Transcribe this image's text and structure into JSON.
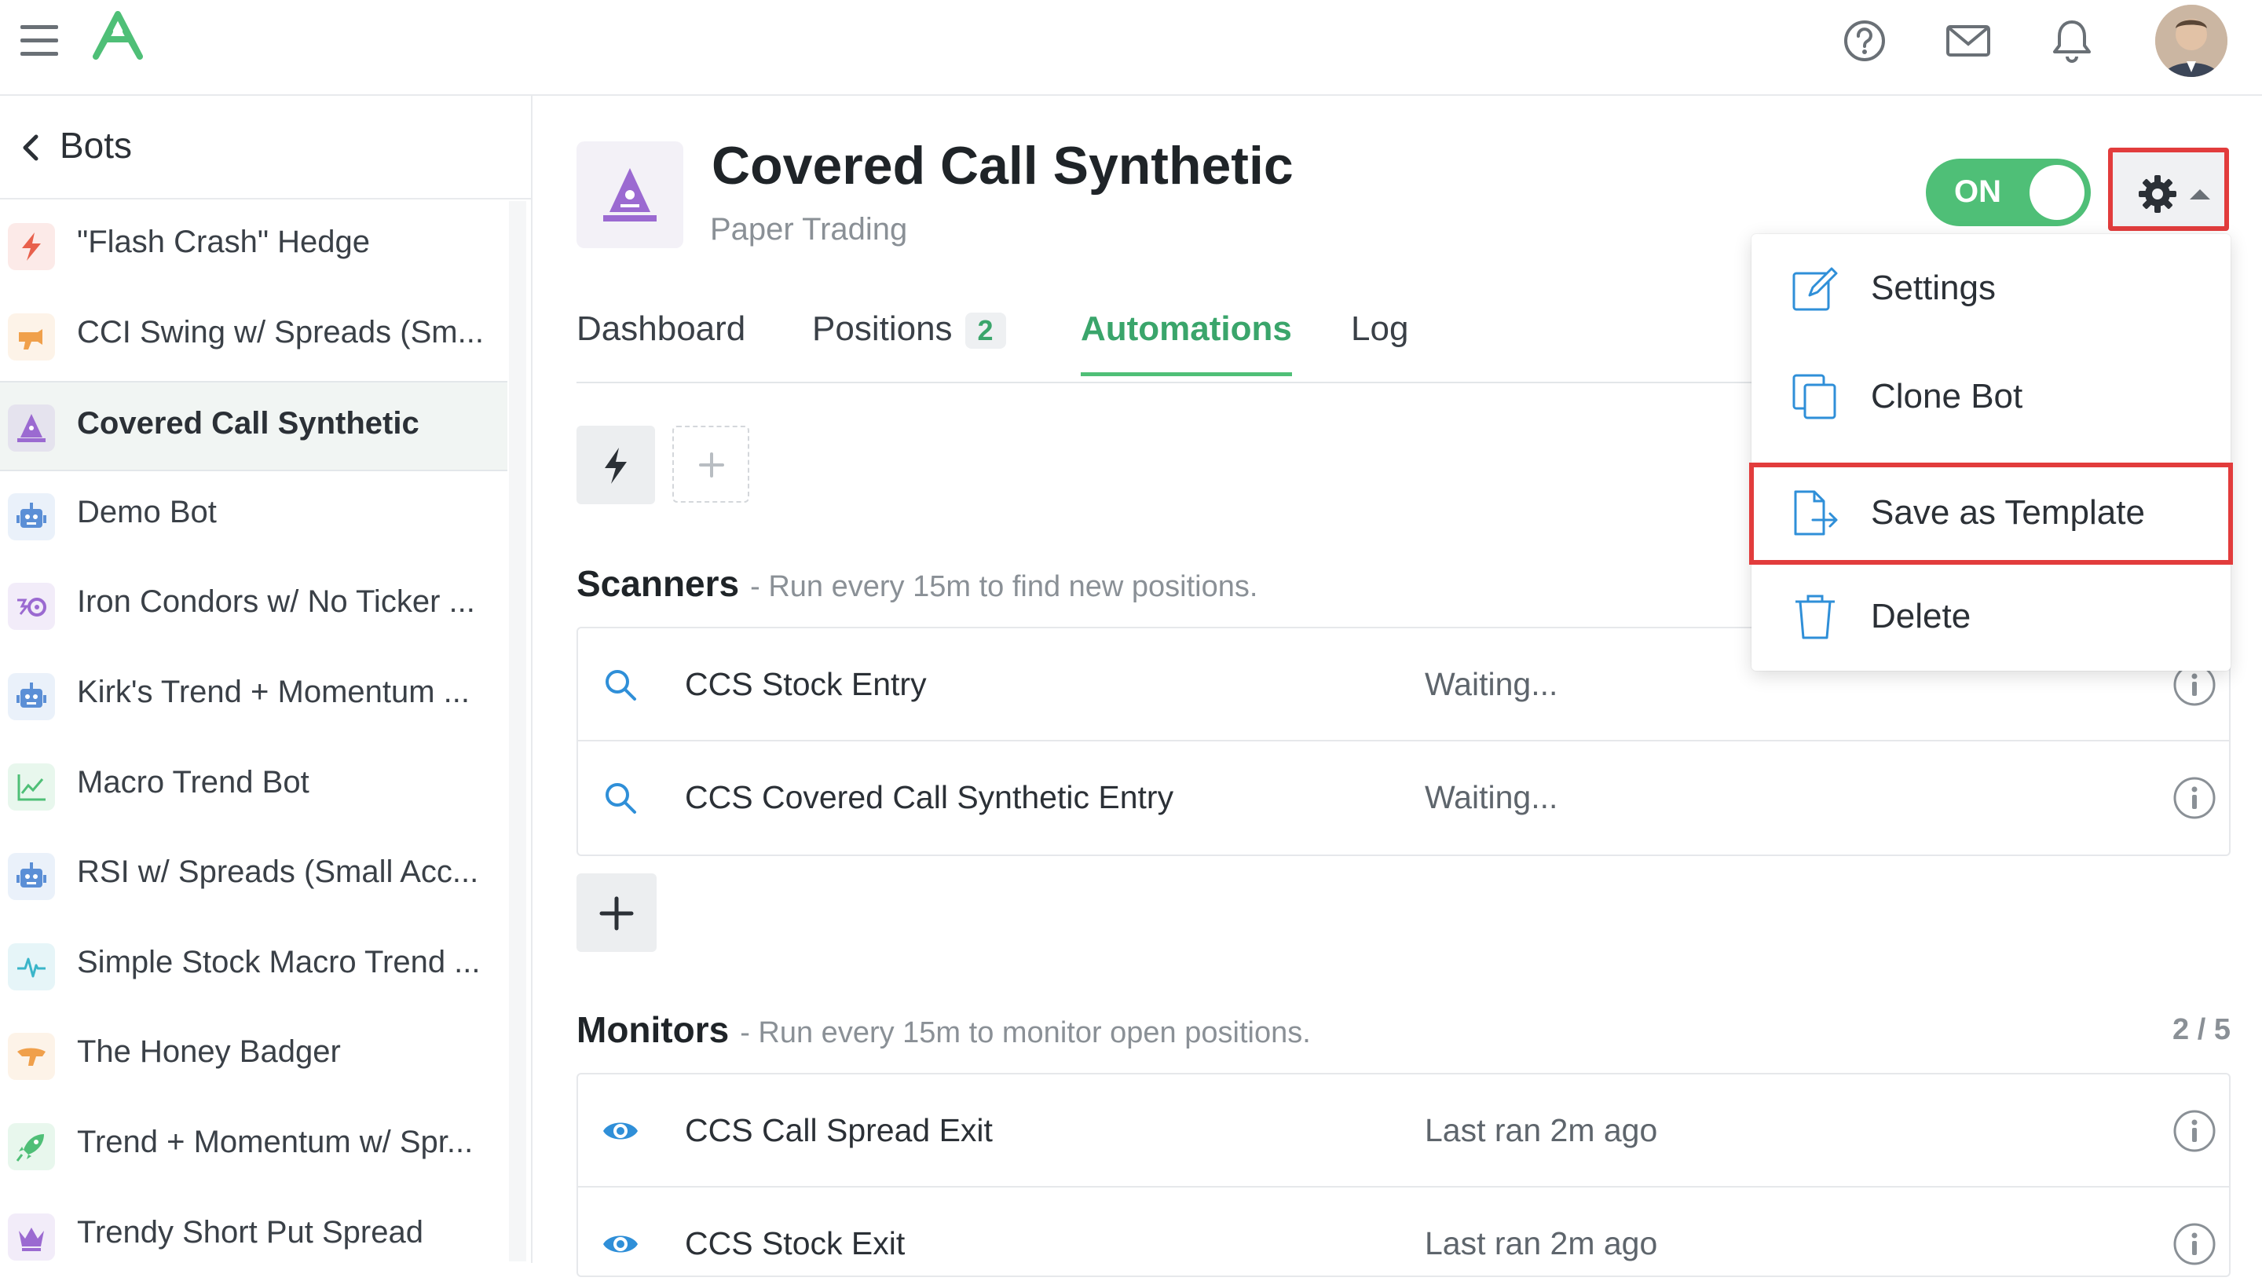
{
  "topbar": {
    "icons": [
      "menu-icon",
      "logo-icon",
      "help-icon",
      "mail-icon",
      "bell-icon",
      "avatar"
    ]
  },
  "sidebar": {
    "back_label": "Bots",
    "items": [
      {
        "label": "\"Flash Crash\" Hedge",
        "icon": "bolt-icon",
        "color": "#e8604c"
      },
      {
        "label": "CCI Swing w/ Spreads (Sm...",
        "icon": "raygun-icon",
        "color": "#f0a04b"
      },
      {
        "label": "Covered Call Synthetic",
        "icon": "wizard-icon",
        "color": "#9b6ad1",
        "active": true
      },
      {
        "label": "Demo Bot",
        "icon": "robot-icon",
        "color": "#5b8fd6"
      },
      {
        "label": "Iron Condors w/ No Ticker ...",
        "icon": "condor-icon",
        "color": "#9b6ad1"
      },
      {
        "label": "Kirk's Trend + Momentum ...",
        "icon": "robot-icon",
        "color": "#5b8fd6"
      },
      {
        "label": "Macro Trend Bot",
        "icon": "chart-icon",
        "color": "#4fbf77"
      },
      {
        "label": "RSI w/ Spreads (Small Acc...",
        "icon": "robot-icon",
        "color": "#5b8fd6"
      },
      {
        "label": "Simple Stock Macro Trend ...",
        "icon": "pulse-icon",
        "color": "#3ab5c9"
      },
      {
        "label": "The Honey Badger",
        "icon": "badger-icon",
        "color": "#f0a04b"
      },
      {
        "label": "Trend + Momentum w/ Spr...",
        "icon": "rocket-icon",
        "color": "#4fbf77"
      },
      {
        "label": "Trendy Short Put Spread",
        "icon": "crown-icon",
        "color": "#9b6ad1"
      }
    ]
  },
  "header": {
    "title": "Covered Call Synthetic",
    "subtitle": "Paper Trading",
    "toggle_label": "ON"
  },
  "tabs": [
    {
      "label": "Dashboard"
    },
    {
      "label": "Positions",
      "badge": "2"
    },
    {
      "label": "Automations",
      "active": true
    },
    {
      "label": "Log"
    }
  ],
  "scanners": {
    "title": "Scanners",
    "description": "- Run every 15m to find new positions.",
    "rows": [
      {
        "name": "CCS Stock Entry",
        "status": "Waiting..."
      },
      {
        "name": "CCS Covered Call Synthetic Entry",
        "status": "Waiting..."
      }
    ]
  },
  "monitors": {
    "title": "Monitors",
    "description": "- Run every 15m to monitor open positions.",
    "count": "2 / 5",
    "rows": [
      {
        "name": "CCS Call Spread Exit",
        "status": "Last ran 2m ago"
      },
      {
        "name": "CCS Stock Exit",
        "status": "Last ran 2m ago"
      }
    ]
  },
  "menu": {
    "items": [
      {
        "label": "Settings",
        "icon": "edit-icon"
      },
      {
        "label": "Clone Bot",
        "icon": "copy-icon"
      },
      {
        "label": "Save as Template",
        "icon": "file-export-icon"
      },
      {
        "label": "Delete",
        "icon": "trash-icon"
      }
    ]
  },
  "colors": {
    "accent": "#4fbf77",
    "highlight": "#e23c3c",
    "icon_blue": "#2f8fd8"
  }
}
